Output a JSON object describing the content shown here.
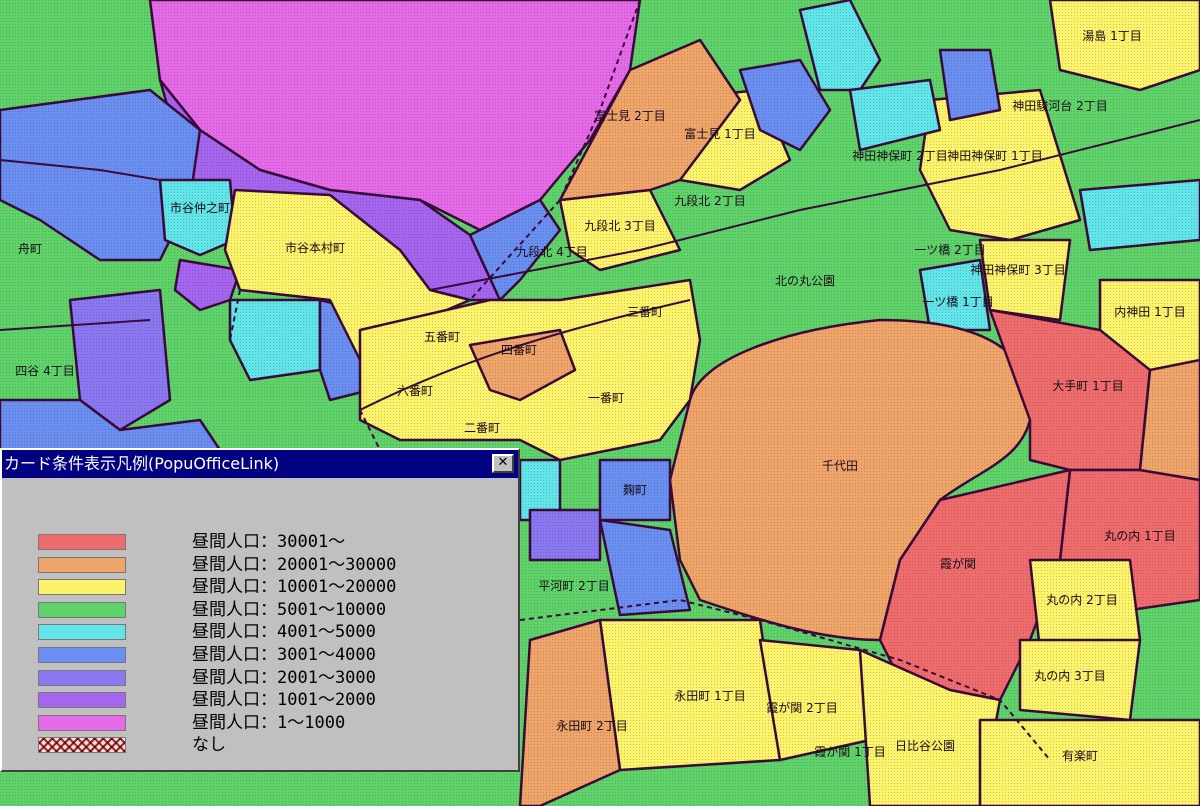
{
  "colors": {
    "green": "#5fd36a",
    "yellow": "#fbf36b",
    "orange": "#efa56a",
    "red": "#ef6c6c",
    "cyan": "#62e5e8",
    "blue": "#6b8ff0",
    "purple": "#a565ee",
    "magenta": "#e46ae8",
    "border": "#3a0a3a",
    "window_title_bg": "#000080",
    "window_bg": "#c0c0c0"
  },
  "map": {
    "labels": {
      "imperial_palace": "千代田",
      "kitanomaru": "北の丸公園",
      "kasumigaseki": "霞が関",
      "hibiya": "日比谷公園",
      "ichigaya_honmura": "市谷本村町",
      "sanbancho": "三番町",
      "ichibancho": "一番町",
      "nibancho": "二番町",
      "gobancho": "五番町",
      "yonbancho": "四番町",
      "rokubancho": "六番町",
      "kudankita3": "九段北 3丁目",
      "kudankita2": "九段北 2丁目",
      "kudankita4": "九段北 4丁目",
      "fujimi1": "富士見 1丁目",
      "fujimi2": "富士見 2丁目",
      "otemachi1": "大手町 1丁目",
      "marunouchi1": "丸の内 1丁目",
      "marunouchi2": "丸の内 2丁目",
      "marunouchi3": "丸の内 3丁目",
      "nagatacho1": "永田町 1丁目",
      "nagatacho2": "永田町 2丁目",
      "kasumigaseki2": "霞が関 2丁目",
      "kasumigaseki1": "霞が関 1丁目",
      "yurakucho": "有楽町",
      "hirakawacho2": "平河町 2丁目",
      "yotsuya4": "四谷 4丁目",
      "kanda_jinbocho3": "神田神保町 3丁目",
      "kanda_jinbocho1": "神田神保町 1丁目",
      "kanda_jinbocho2": "神田神保町 2丁目",
      "yushima1": "湯島 1丁目",
      "uchikanda": "内神田 1丁目",
      "hitotsubashi1": "一ツ橋 1丁目",
      "hitotsubashi2": "一ツ橋 2丁目",
      "kojimachi": "麹町",
      "ichigaya_tanimachi": "市谷仲之町",
      "funagawara": "舟町",
      "kanda_surugadai": "神田駿河台 2丁目"
    }
  },
  "legend": {
    "title": "カード条件表示凡例(PopuOfficeLink)",
    "close_label": "✕",
    "items": [
      {
        "label": "昼間人口：30001～",
        "color": "#ef6c6c"
      },
      {
        "label": "昼間人口：20001～30000",
        "color": "#efa56a"
      },
      {
        "label": "昼間人口：10001～20000",
        "color": "#fbf36b"
      },
      {
        "label": "昼間人口：5001～10000",
        "color": "#5fd36a"
      },
      {
        "label": "昼間人口：4001～5000",
        "color": "#62e5e8"
      },
      {
        "label": "昼間人口：3001～4000",
        "color": "#6b8ff0"
      },
      {
        "label": "昼間人口：2001～3000",
        "color": "#8a78f0"
      },
      {
        "label": "昼間人口：1001～2000",
        "color": "#a565ee"
      },
      {
        "label": "昼間人口：1～1000",
        "color": "#e46ae8"
      },
      {
        "label": "なし",
        "color": "hatch"
      }
    ]
  }
}
